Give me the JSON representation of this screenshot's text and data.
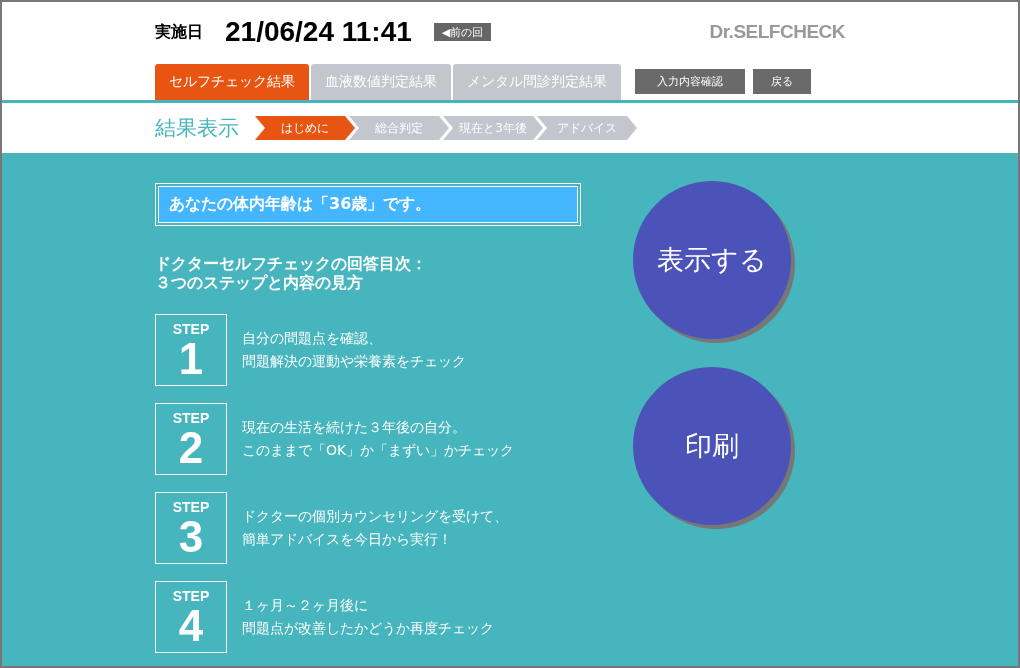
{
  "header": {
    "date_label": "実施日",
    "date": "21/06/24 11:41",
    "prev_button": "◀前の回",
    "logo": "Dr.SELFCHECK"
  },
  "tabs": [
    {
      "label": "セルフチェック結果",
      "selected": true
    },
    {
      "label": "血液数値判定結果",
      "selected": false
    },
    {
      "label": "メンタル問診判定結果",
      "selected": false
    }
  ],
  "actions": [
    "入力内容確認",
    "戻る"
  ],
  "breadcrumb": {
    "title": "結果表示",
    "steps": [
      {
        "label": "はじめに",
        "selected": true
      },
      {
        "label": "総合判定",
        "selected": false
      },
      {
        "label": "現在と3年後",
        "selected": false
      },
      {
        "label": "アドバイス",
        "selected": false
      }
    ]
  },
  "age_banner": "あなたの体内年齢は「36歳」です。",
  "guide_title": [
    "ドクターセルフチェックの回答目次：",
    "３つのステップと内容の見方"
  ],
  "steps": [
    {
      "label": "STEP",
      "number": "1",
      "lines": [
        "自分の問題点を確認、",
        "問題解決の運動や栄養素をチェック"
      ]
    },
    {
      "label": "STEP",
      "number": "2",
      "lines": [
        "現在の生活を続けた３年後の自分。",
        "このままで「OK」か「まずい」かチェック"
      ]
    },
    {
      "label": "STEP",
      "number": "3",
      "lines": [
        "ドクターの個別カウンセリングを受けて、",
        "簡単アドバイスを今日から実行！"
      ]
    },
    {
      "label": "STEP",
      "number": "4",
      "lines": [
        "１ヶ月～２ヶ月後に",
        "問題点が改善したかどうか再度チェック"
      ]
    }
  ],
  "circle_buttons": [
    "表示する",
    "印刷"
  ]
}
